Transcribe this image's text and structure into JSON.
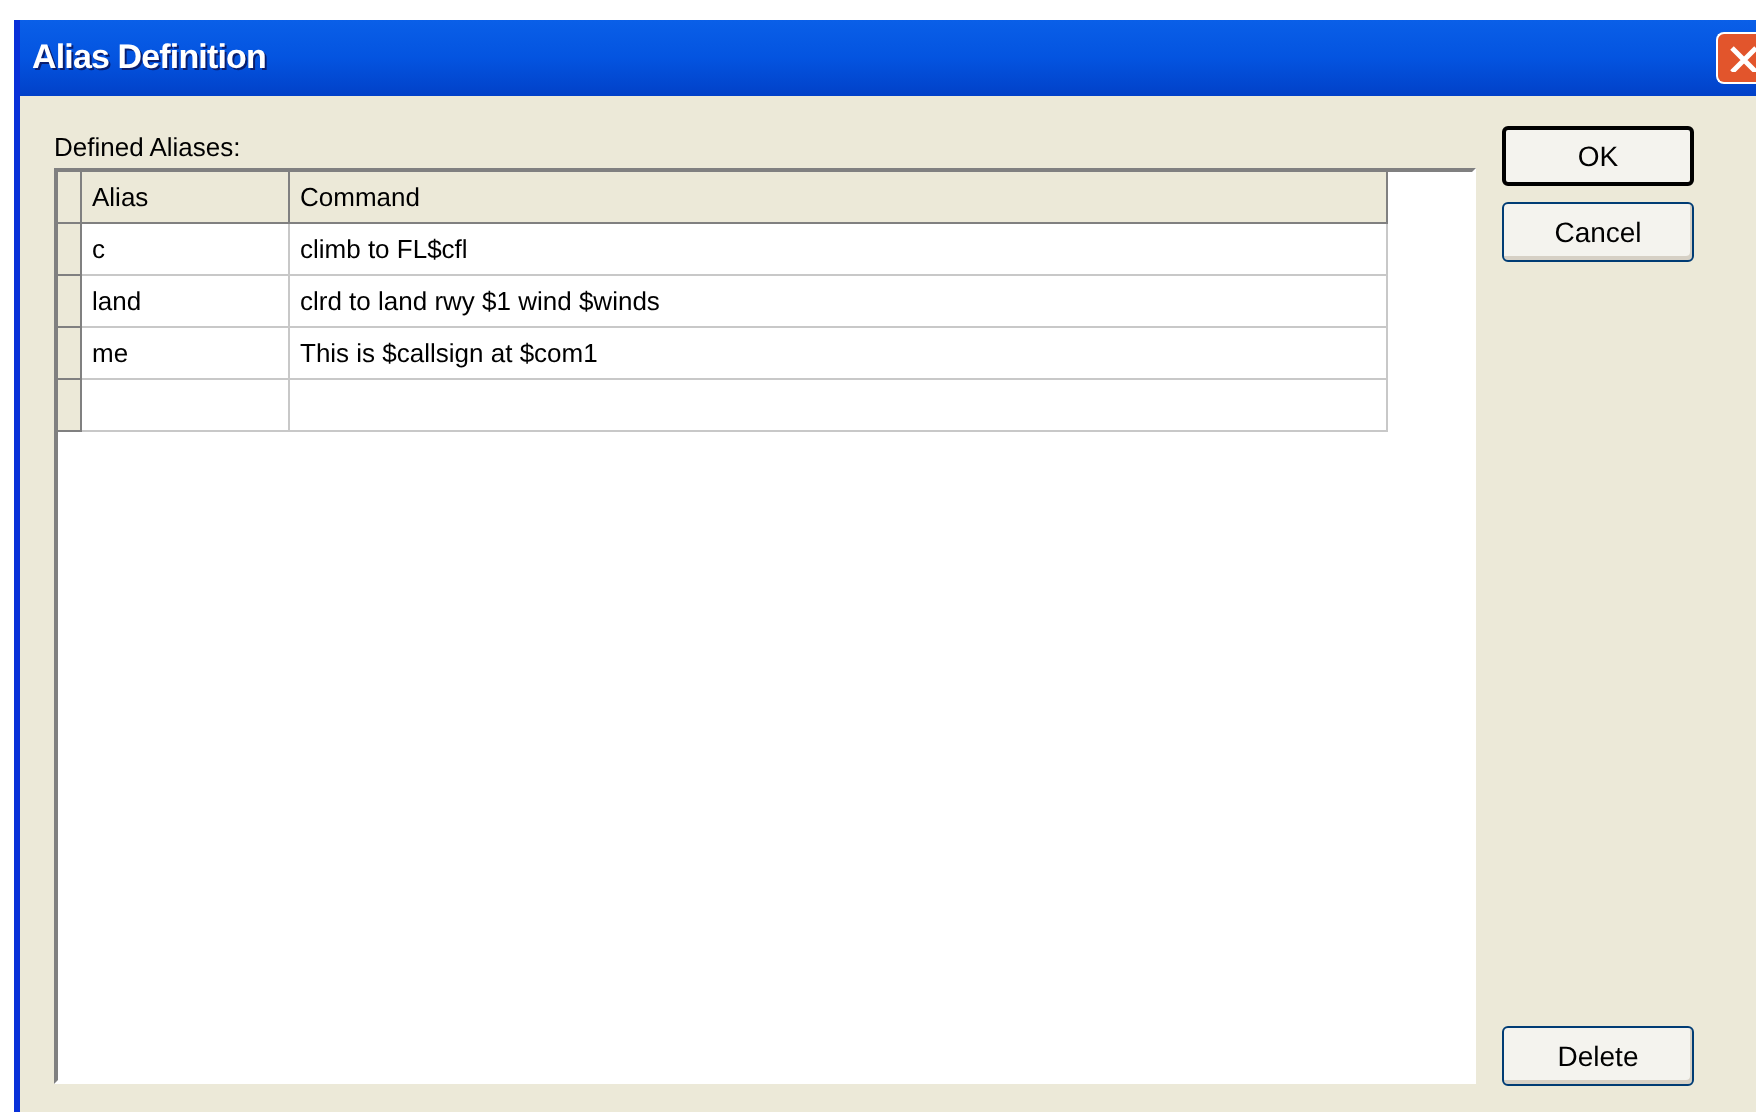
{
  "window": {
    "title": "Alias Definition"
  },
  "label": "Defined Aliases:",
  "table": {
    "columns": [
      "Alias",
      "Command"
    ],
    "rows": [
      [
        "c",
        "climb to FL$cfl"
      ],
      [
        "land",
        "clrd to land rwy $1 wind $winds"
      ],
      [
        "me",
        "This is $callsign at $com1"
      ],
      [
        "",
        ""
      ]
    ]
  },
  "buttons": {
    "ok": "OK",
    "cancel": "Cancel",
    "delete": "Delete"
  }
}
